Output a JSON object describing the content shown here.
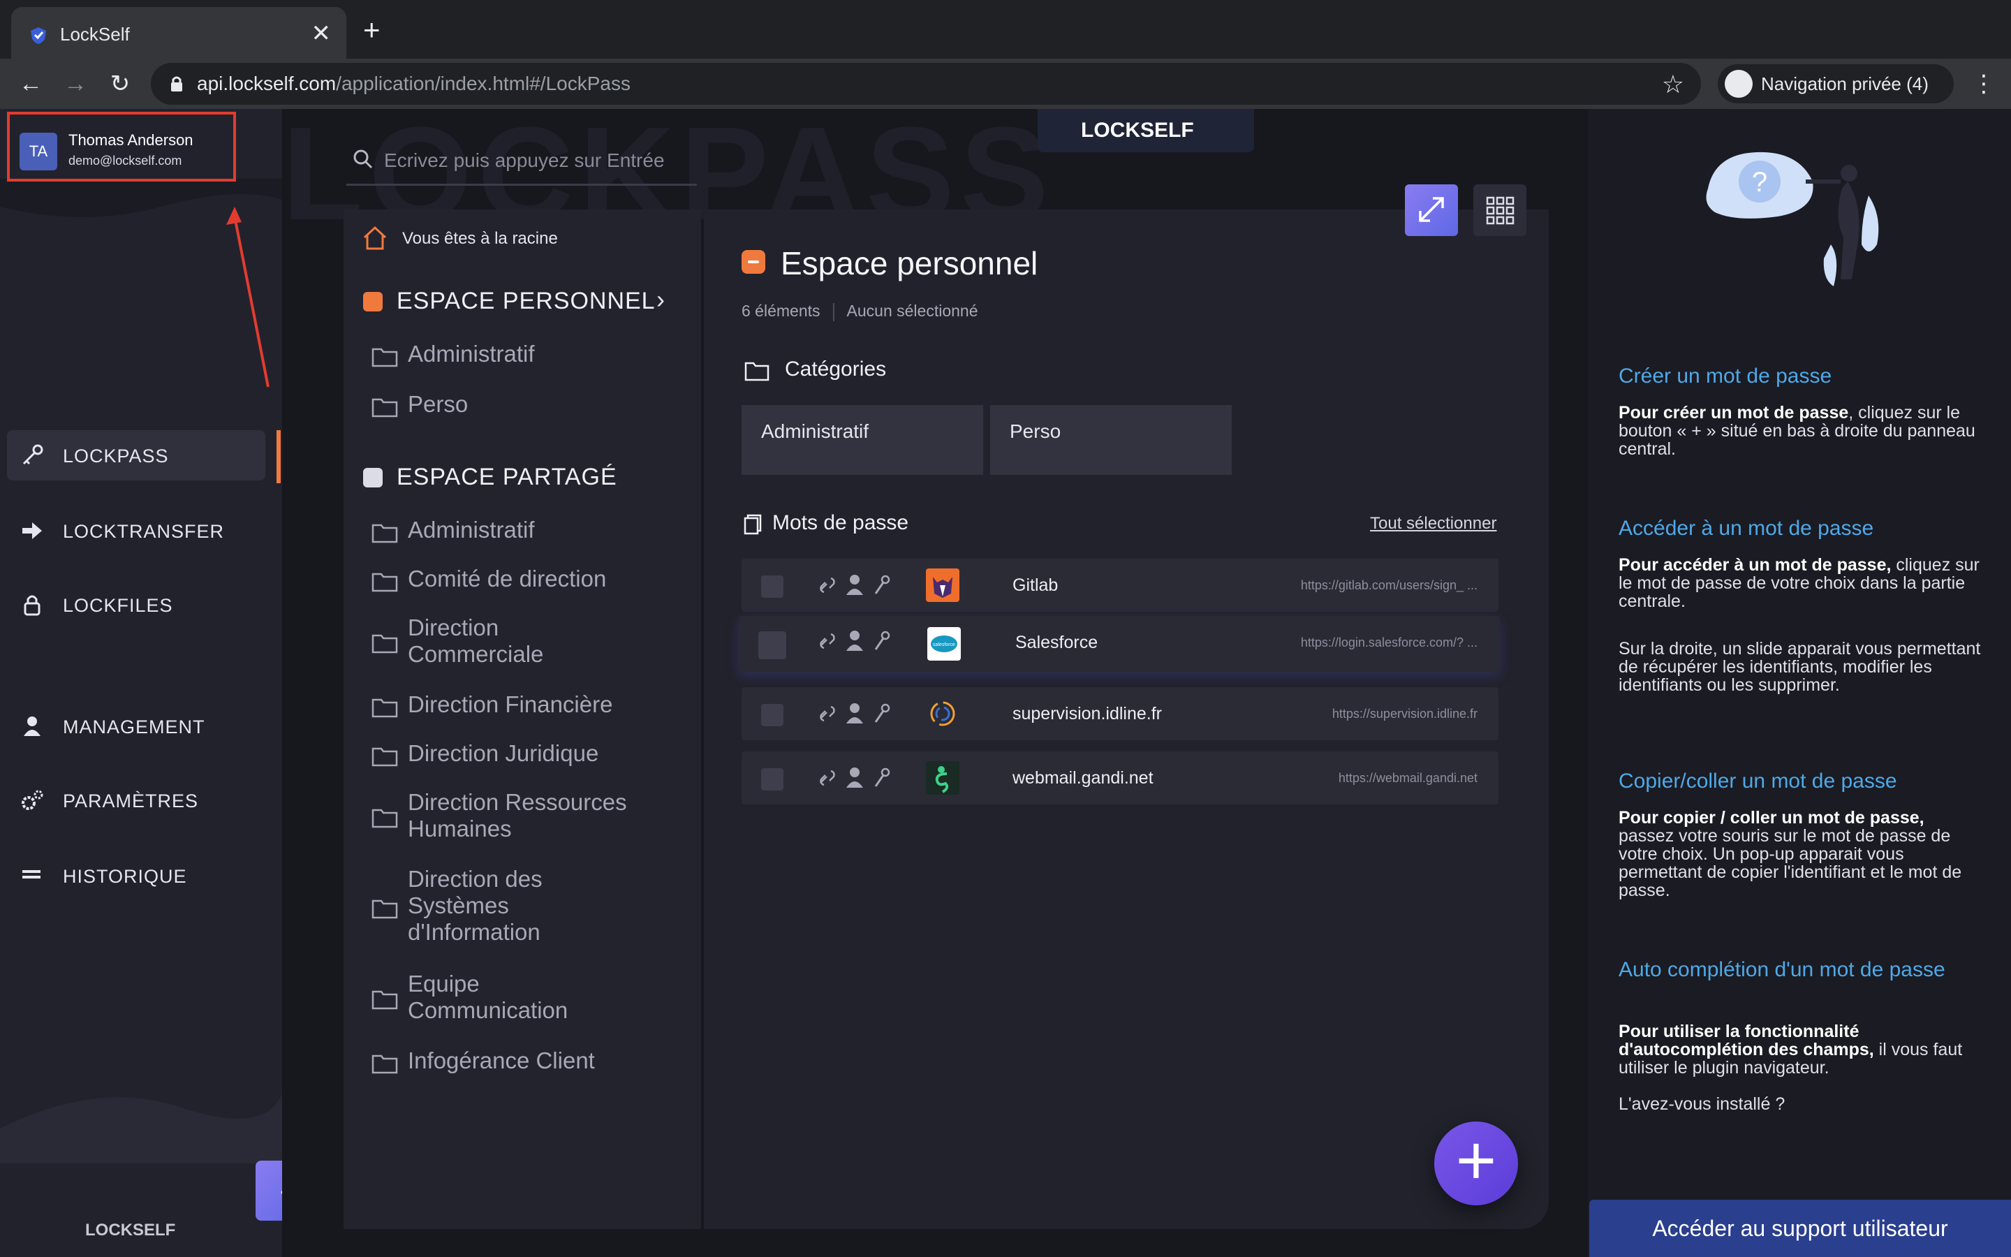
{
  "browser": {
    "tab_title": "LockSelf",
    "tab_close": "✕",
    "new_tab": "+",
    "url_host": "api.lockself.com",
    "url_path": "/application/index.html#/LockPass",
    "incognito_label": "Navigation privée (4)"
  },
  "watermark": "LOCKPASS",
  "brand": "LOCKSELF",
  "user": {
    "initials": "TA",
    "name": "Thomas Anderson",
    "email": "demo@lockself.com"
  },
  "sidebar": {
    "items": [
      {
        "label": "LOCKPASS",
        "icon": "key-icon",
        "active": true
      },
      {
        "label": "LOCKTRANSFER",
        "icon": "arrow-right-icon",
        "active": false
      },
      {
        "label": "LOCKFILES",
        "icon": "lock-icon",
        "active": false
      },
      {
        "label": "MANAGEMENT",
        "icon": "user-icon",
        "active": false
      },
      {
        "label": "PARAMÈTRES",
        "icon": "gear-icon",
        "active": false
      },
      {
        "label": "HISTORIQUE",
        "icon": "list-icon",
        "active": false
      }
    ],
    "collapse": "‹",
    "footer_logo": "LOCKSELF"
  },
  "search": {
    "placeholder": "Ecrivez puis appuyez sur Entrée"
  },
  "tree": {
    "root_label": "Vous êtes à la racine",
    "personal": {
      "label": "ESPACE PERSONNEL",
      "folders": [
        "Administratif",
        "Perso"
      ]
    },
    "shared": {
      "label": "ESPACE PARTAGÉ",
      "folders": [
        "Administratif",
        "Comité de direction",
        "Direction Commerciale",
        "Direction Financière",
        "Direction Juridique",
        "Direction Ressources Humaines",
        "Direction des Systèmes d'Information",
        "Equipe Communication",
        "Infogérance Client"
      ]
    }
  },
  "main": {
    "title": "Espace personnel",
    "count": "6 éléments",
    "selected": "Aucun sélectionné",
    "categories_label": "Catégories",
    "categories": [
      "Administratif",
      "Perso"
    ],
    "passwords_label": "Mots de passe",
    "select_all": "Tout sélectionner",
    "passwords": [
      {
        "name": "Gitlab",
        "url": "https://gitlab.com/users/sign_ ...",
        "logo": "gitlab-logo"
      },
      {
        "name": "Salesforce",
        "url": "https://login.salesforce.com/? ...",
        "logo": "salesforce-logo"
      },
      {
        "name": "supervision.idline.fr",
        "url": "https://supervision.idline.fr",
        "logo": "idline-logo"
      },
      {
        "name": "webmail.gandi.net",
        "url": "https://webmail.gandi.net",
        "logo": "gandi-logo"
      }
    ],
    "fab": "+"
  },
  "help": {
    "sections": [
      {
        "title": "Créer un mot de passe",
        "bold": "Pour créer un mot de passe",
        "text": ", cliquez sur le bouton « + » situé en bas à droite du panneau central."
      },
      {
        "title": "Accéder à un mot de passe",
        "bold": "Pour accéder à un mot de passe,",
        "text": " cliquez sur le mot de passe de votre choix dans la partie centrale.",
        "extra": "Sur la droite, un slide apparait vous permettant de récupérer les identifiants, modifier les identifiants ou les supprimer."
      },
      {
        "title": "Copier/coller un mot de passe",
        "bold": "Pour copier / coller un mot de passe,",
        "text": " passez votre souris sur le mot de passe de votre choix. Un pop-up apparait vous permettant de copier l'identifiant et le mot de passe."
      },
      {
        "title": "Auto complétion d'un mot de passe",
        "bold": "Pour utiliser la fonctionnalité d'autocomplétion des champs,",
        "text": " il vous faut utiliser le plugin navigateur.",
        "extra": "L'avez-vous installé ?"
      }
    ],
    "support_button": "Accéder au support utilisateur"
  },
  "colors": {
    "accent_orange": "#f07a3d",
    "accent_purple": "#6a5ae8",
    "link_blue": "#4ea9e8",
    "highlight_red": "#e23c2f"
  }
}
